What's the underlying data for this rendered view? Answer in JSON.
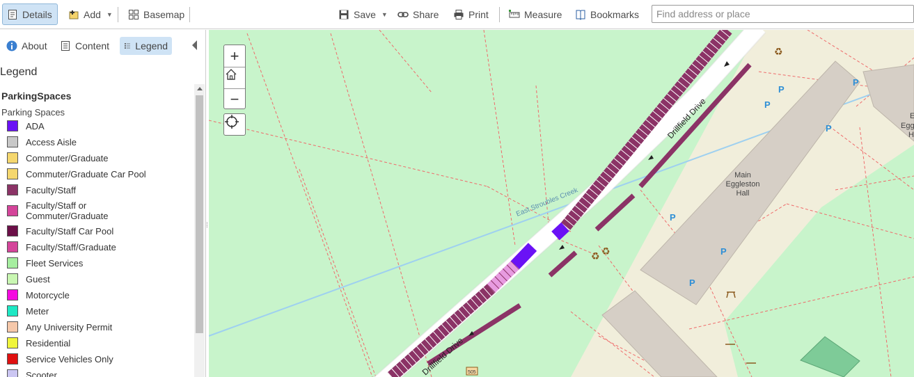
{
  "toolbar": {
    "details_label": "Details",
    "add_label": "Add",
    "basemap_label": "Basemap",
    "save_label": "Save",
    "share_label": "Share",
    "print_label": "Print",
    "measure_label": "Measure",
    "bookmarks_label": "Bookmarks",
    "search_placeholder": "Find address or place"
  },
  "panel": {
    "tabs": [
      {
        "label": "About",
        "icon": "info-icon"
      },
      {
        "label": "Content",
        "icon": "content-icon"
      },
      {
        "label": "Legend",
        "icon": "legend-icon",
        "active": true
      }
    ],
    "title": "Legend"
  },
  "legend": {
    "layer": "ParkingSpaces",
    "sublayer": "Parking Spaces",
    "items": [
      {
        "label": "ADA",
        "color": "#6a12f5"
      },
      {
        "label": "Access Aisle",
        "color": "#c8c8c8"
      },
      {
        "label": "Commuter/Graduate",
        "color": "#f5d76e"
      },
      {
        "label": "Commuter/Graduate Car Pool",
        "color": "#f5d76e"
      },
      {
        "label": "Faculty/Staff",
        "color": "#8b3366"
      },
      {
        "label": "Faculty/Staff or Commuter/Graduate",
        "color": "#d4459a"
      },
      {
        "label": "Faculty/Staff Car Pool",
        "color": "#6b0f47"
      },
      {
        "label": "Faculty/Staff/Graduate",
        "color": "#d4459a"
      },
      {
        "label": "Fleet Services",
        "color": "#a6eea0"
      },
      {
        "label": "Guest",
        "color": "#c9f7b2"
      },
      {
        "label": "Motorcycle",
        "color": "#f50ae0"
      },
      {
        "label": "Meter",
        "color": "#1ee8c4"
      },
      {
        "label": "Any University Permit",
        "color": "#f6c8aa"
      },
      {
        "label": "Residential",
        "color": "#f0f53c"
      },
      {
        "label": "Service Vehicles Only",
        "color": "#e01010"
      },
      {
        "label": "Scooter",
        "color": "#cbc6f2"
      }
    ]
  },
  "map": {
    "zoom_in": "+",
    "zoom_out": "−",
    "road_label": "Drillfield Drive",
    "creek_label": "East Stroubles Creek",
    "building_label_1": "Main",
    "building_label_2": "Eggleston",
    "building_label_3": "Hall",
    "partial_label_1": "E",
    "partial_label_2": "Egg",
    "partial_label_3": "H",
    "route_shield": "505",
    "parking_symbol": "P"
  }
}
